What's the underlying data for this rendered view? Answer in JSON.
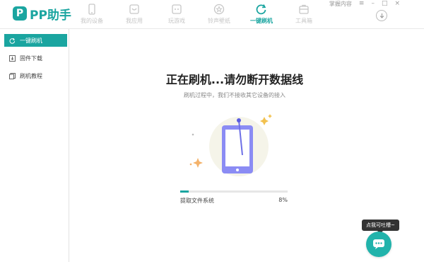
{
  "app": {
    "logo_mark": "P",
    "logo_text": "PP助手"
  },
  "nav": {
    "items": [
      {
        "label": "我的设备",
        "icon": "phone-icon"
      },
      {
        "label": "我应用",
        "icon": "app-icon"
      },
      {
        "label": "玩游戏",
        "icon": "gamepad-icon"
      },
      {
        "label": "铃声壁纸",
        "icon": "star-icon"
      },
      {
        "label": "一键刷机",
        "icon": "refresh-icon",
        "active": true
      },
      {
        "label": "工具箱",
        "icon": "toolbox-icon"
      }
    ]
  },
  "window_controls": {
    "feedback_label": "掌握内容",
    "menu": "≡",
    "minimize": "–",
    "maximize": "□",
    "close": "×",
    "download_icon": "download-icon"
  },
  "sidebar": {
    "items": [
      {
        "label": "一键刷机",
        "icon": "refresh-icon",
        "active": true
      },
      {
        "label": "固件下载",
        "icon": "download-icon"
      },
      {
        "label": "刷机教程",
        "icon": "document-icon"
      }
    ]
  },
  "main": {
    "title": "正在刷机...请勿断开数据线",
    "subtitle": "刷机过程中，我们不接收其它设备的接入",
    "progress_label": "提取文件系统",
    "progress_percent_text": "8%",
    "progress_value": 0.08
  },
  "chat": {
    "tooltip": "点我可吐槽~"
  },
  "colors": {
    "accent": "#1aa5a0",
    "phone": "#8b8cf4",
    "sparkle": "#f2c14e"
  }
}
